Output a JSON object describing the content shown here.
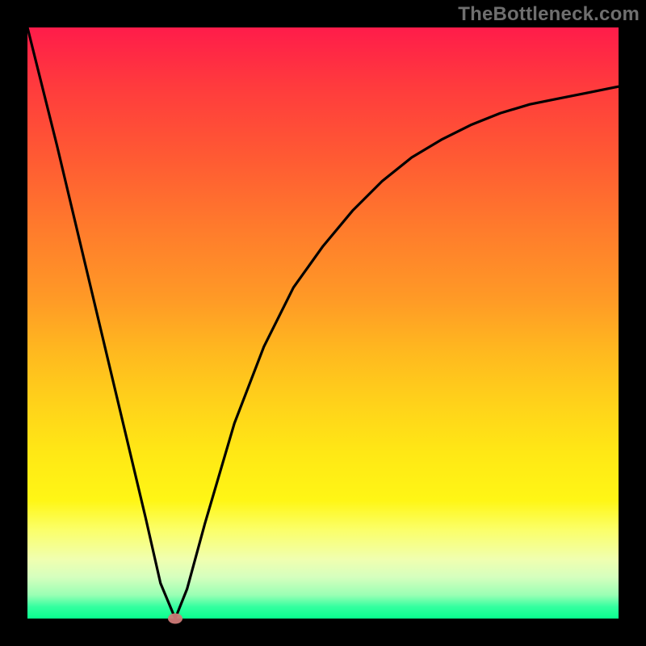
{
  "watermark_text": "TheBottleneck.com",
  "chart_data": {
    "type": "line",
    "title": "",
    "xlabel": "",
    "ylabel": "",
    "xlim": [
      0,
      100
    ],
    "ylim": [
      0,
      100
    ],
    "grid": false,
    "series": [
      {
        "name": "curve",
        "x": [
          0,
          5,
          10,
          15,
          20,
          22.5,
          25,
          27,
          30,
          35,
          40,
          45,
          50,
          55,
          60,
          65,
          70,
          75,
          80,
          85,
          90,
          95,
          100
        ],
        "y": [
          100,
          80,
          59,
          38,
          17,
          6,
          0,
          5,
          16,
          33,
          46,
          56,
          63,
          69,
          74,
          78,
          81,
          83.5,
          85.5,
          87,
          88,
          89,
          90
        ]
      }
    ],
    "marker": {
      "x": 25,
      "y": 0
    },
    "background_gradient": {
      "direction": "vertical",
      "stops": [
        {
          "pos": 0,
          "color": "#ff1c4a"
        },
        {
          "pos": 50,
          "color": "#ffa524"
        },
        {
          "pos": 80,
          "color": "#fff615"
        },
        {
          "pos": 100,
          "color": "#08ff8e"
        }
      ]
    }
  }
}
